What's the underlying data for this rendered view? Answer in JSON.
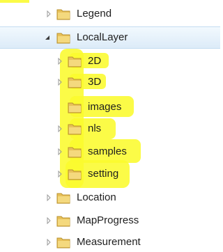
{
  "tree": {
    "items": [
      {
        "label": "Legend",
        "expanded": false,
        "selected": false,
        "level": 0
      },
      {
        "label": "LocalLayer",
        "expanded": true,
        "selected": true,
        "level": 0
      },
      {
        "label": "2D",
        "expanded": false,
        "selected": false,
        "level": 1
      },
      {
        "label": "3D",
        "expanded": false,
        "selected": false,
        "level": 1
      },
      {
        "label": "images",
        "expanded": false,
        "selected": false,
        "level": 1,
        "no_children": true
      },
      {
        "label": "nls",
        "expanded": false,
        "selected": false,
        "level": 1
      },
      {
        "label": "samples",
        "expanded": false,
        "selected": false,
        "level": 1
      },
      {
        "label": "setting",
        "expanded": false,
        "selected": false,
        "level": 1
      },
      {
        "label": "Location",
        "expanded": false,
        "selected": false,
        "level": 0
      },
      {
        "label": "MapProgress",
        "expanded": false,
        "selected": false,
        "level": 0
      },
      {
        "label": "Measurement",
        "expanded": false,
        "selected": false,
        "level": 0
      }
    ]
  },
  "colors": {
    "highlight": "#fbfb2d",
    "selection": "#dcebf8",
    "folder": "#e8c15a"
  },
  "icons": {
    "collapsed": "triangle-right-icon",
    "expanded": "triangle-down-right-icon",
    "folder": "folder-icon"
  }
}
